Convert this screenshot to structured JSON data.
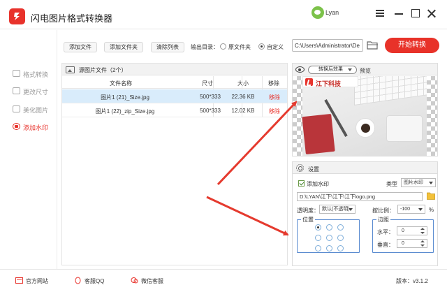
{
  "app": {
    "title": "闪电图片格式转换器",
    "user": "Lyan"
  },
  "sidebar": {
    "items": [
      {
        "label": "格式转换",
        "active": false
      },
      {
        "label": "更改尺寸",
        "active": false
      },
      {
        "label": "美化图片",
        "active": false
      },
      {
        "label": "添加水印",
        "active": true
      }
    ]
  },
  "toolbar": {
    "add_file": "添加文件",
    "add_folder": "添加文件夹",
    "clear_list": "清除列表",
    "output_label": "输出目录：",
    "option_original": "原文件夹",
    "option_custom": "自定义",
    "output_path": "C:\\Users\\Administrator\\De",
    "start": "开始转换"
  },
  "files": {
    "title": "源图片文件（2个）",
    "columns": [
      "文件名称",
      "尺寸",
      "大小",
      "移除"
    ],
    "rows": [
      {
        "name": "图片1 (21)_Size.jpg",
        "dims": "500*333",
        "size": "22.36 KB",
        "remove": "移除"
      },
      {
        "name": "图片1 (22)_zip_Size.jpg",
        "dims": "500*333",
        "size": "12.02 KB",
        "remove": "移除"
      }
    ]
  },
  "preview": {
    "mode": "转换后效果",
    "label": "预览",
    "watermark_text": "江下科技"
  },
  "settings": {
    "title": "设置",
    "add_watermark": "添加水印",
    "type_label": "类型",
    "type_value": "图片水印",
    "logo_path": "D:\\LYAN\\江下\\江下\\江下logo.png",
    "opacity_label": "透明度：",
    "opacity_value": "默认(不透明)",
    "scale_label": "按比例：",
    "scale_value": "-100",
    "scale_unit": "%",
    "position_label": "位置",
    "margin_label": "边距",
    "horizontal_label": "水平：",
    "horizontal_value": "0",
    "vertical_label": "垂直：",
    "vertical_value": "0"
  },
  "footer": {
    "website": "官方网站",
    "qq": "客服QQ",
    "wechat": "微信客服",
    "version": "版本：v3.1.2"
  },
  "colors": {
    "accent": "#e8322b",
    "selection": "#d9ecfb",
    "arrow": "#e53a2e"
  }
}
